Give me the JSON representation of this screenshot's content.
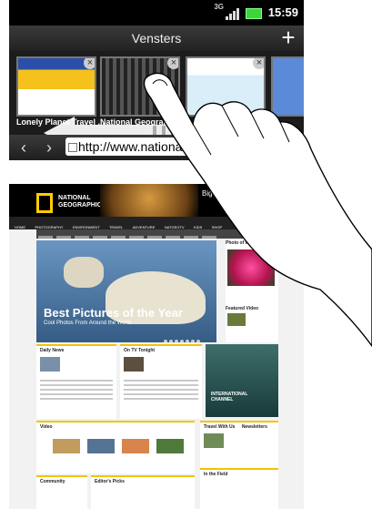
{
  "status_bar": {
    "network": "3G",
    "time": "15:59"
  },
  "title_bar": {
    "title": "Vensters",
    "new_window_icon": "plus-icon"
  },
  "windows": [
    {
      "label": "Lonely Planet Travel ...",
      "close": "×"
    },
    {
      "label": "National Geographic ...",
      "close": "×"
    },
    {
      "label": "",
      "close": "×"
    }
  ],
  "url_bar": {
    "back": "‹",
    "forward": "›",
    "url": "http://www.national..."
  },
  "web_page": {
    "logo_line1": "NATIONAL",
    "logo_line2": "GEOGRAPHIC",
    "banner": "Big Ca",
    "menu": [
      "HOME",
      "PHOTOGRAPHY",
      "ENVIRONMENT",
      "TRAVEL",
      "ADVENTURE",
      "NATGEOTV",
      "KIDS",
      "SHOP"
    ],
    "hero_title": "Best Pictures of the Year",
    "hero_subtitle": "Cool Photos From Around the World",
    "photo_of_day": "Photo of the Day",
    "featured_video": "Featured Video",
    "daily_news": "Daily News",
    "tonight": "On TV Tonight",
    "tv_channel_line1": "INTERNATIONAL",
    "tv_channel_line2": "CHANNEL",
    "video": "Video",
    "travel": "Travel With Us",
    "newsletters": "Newsletters",
    "field": "In the Field",
    "community": "Community",
    "editors": "Editor's Picks"
  }
}
